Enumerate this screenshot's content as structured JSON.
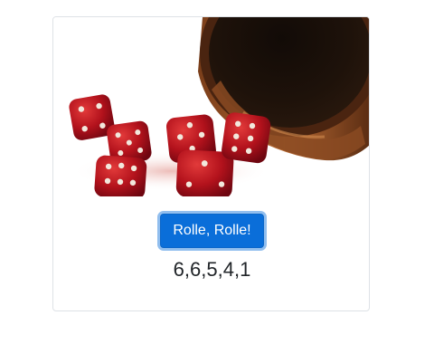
{
  "card": {
    "image_alt": "dice and dice cup",
    "button_label": "Rolle, Rolle!",
    "result": "6,6,5,4,1"
  },
  "colors": {
    "button": "#0a6ed9",
    "dice": "#b3121c",
    "cup": "#3a1e0e"
  },
  "icons": [
    "dice-image"
  ]
}
